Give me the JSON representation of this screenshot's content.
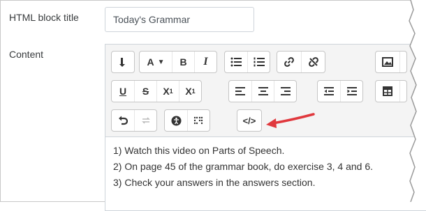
{
  "form": {
    "title_label": "HTML block title",
    "title_value": "Today's Grammar",
    "content_label": "Content"
  },
  "toolbar": {
    "rows": [
      [
        "toggle-toolbar",
        "font-color",
        "bold",
        "italic",
        "unordered-list",
        "ordered-list",
        "link",
        "unlink",
        "image"
      ],
      [
        "underline",
        "strikethrough",
        "subscript",
        "superscript",
        "align-left",
        "align-center",
        "align-right",
        "outdent",
        "indent",
        "table"
      ],
      [
        "undo",
        "redo",
        "accessibility-checker",
        "screenreader-helper",
        "html-source"
      ]
    ],
    "bold": "B",
    "italic": "I",
    "font_color": "A",
    "underline": "U",
    "strike": "S",
    "subscript": "X",
    "subscript_mark": "1",
    "superscript": "X",
    "superscript_mark": "1",
    "html": "</>"
  },
  "content": {
    "lines": [
      "1) Watch this video on Parts of Speech.",
      "2) On page 45 of the grammar book, do exercise 3, 4 and 6.",
      "3) Check your answers in the answers section."
    ]
  },
  "annotation": {
    "arrow_color": "#e0383d"
  }
}
